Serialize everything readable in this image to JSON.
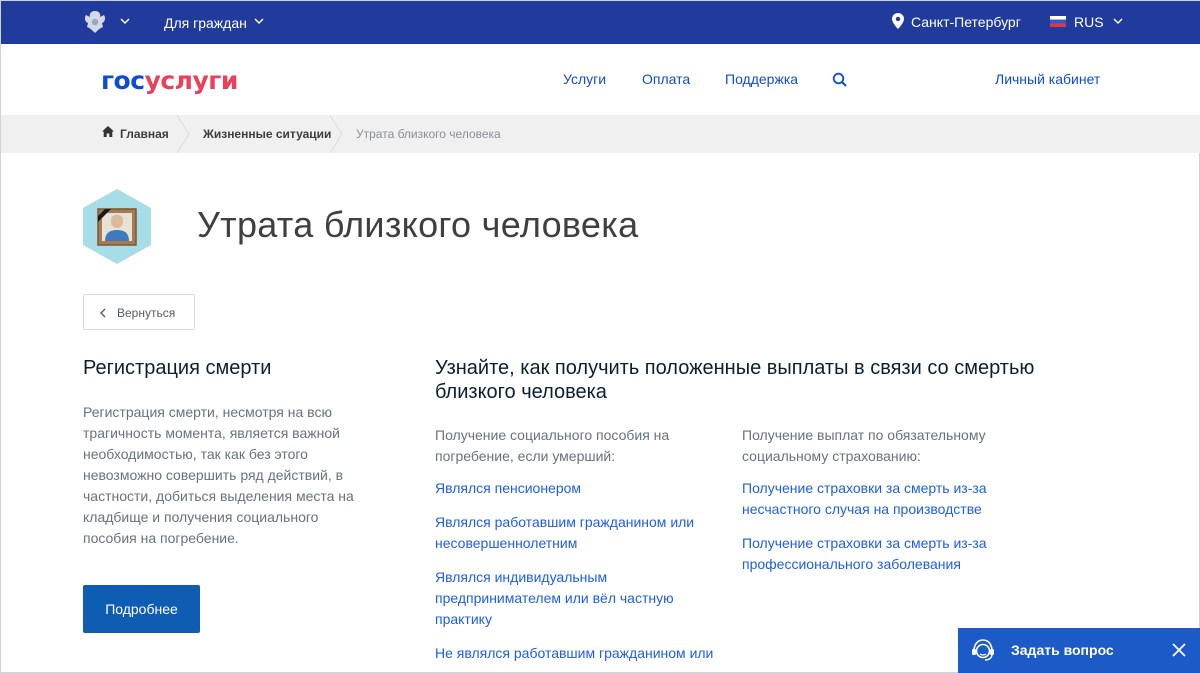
{
  "topbar": {
    "audience_label": "Для граждан",
    "city": "Санкт-Петербург",
    "language": "RUS",
    "bg_color": "#203b9c"
  },
  "header": {
    "logo_part1": "гос",
    "logo_part2": "услуги",
    "nav": [
      "Услуги",
      "Оплата",
      "Поддержка"
    ],
    "cabinet": "Личный кабинет",
    "accent_color": "#0d4cd3",
    "logo_red": "#ee3f58"
  },
  "breadcrumbs": {
    "home": "Главная",
    "section": "Жизненные ситуации",
    "current": "Утрата близкого человека"
  },
  "page": {
    "title": "Утрата близкого человека",
    "back_label": "Вернуться"
  },
  "left": {
    "title": "Регистрация смерти",
    "text": "Регистрация смерти, несмотря на всю трагичность момента, является важной необходимостью, так как без этого невозможно совершить ряд действий, в частности, добиться выделения места на кладбище и получения социального пособия на погребение.",
    "more_label": "Подробнее"
  },
  "right": {
    "title": "Узнайте, как получить положенные выплаты в связи со смертью близкого человека",
    "col1": {
      "intro": "Получение социального пособия на погребение, если умерший:",
      "links": [
        "Являлся пенсионером",
        "Являлся работавшим гражданином или несовершеннолетним",
        "Являлся индивидуальным предпринимателем или вёл частную практику",
        "Не являлся работавшим гражданином или"
      ]
    },
    "col2": {
      "intro": "Получение выплат по обязательному социальному страхованию:",
      "links": [
        "Получение страховки за смерть из-за несчастного случая на производстве",
        "Получение страховки за смерть из-за профессионального заболевания"
      ]
    }
  },
  "ask_widget": {
    "label": "Задать вопрос"
  }
}
